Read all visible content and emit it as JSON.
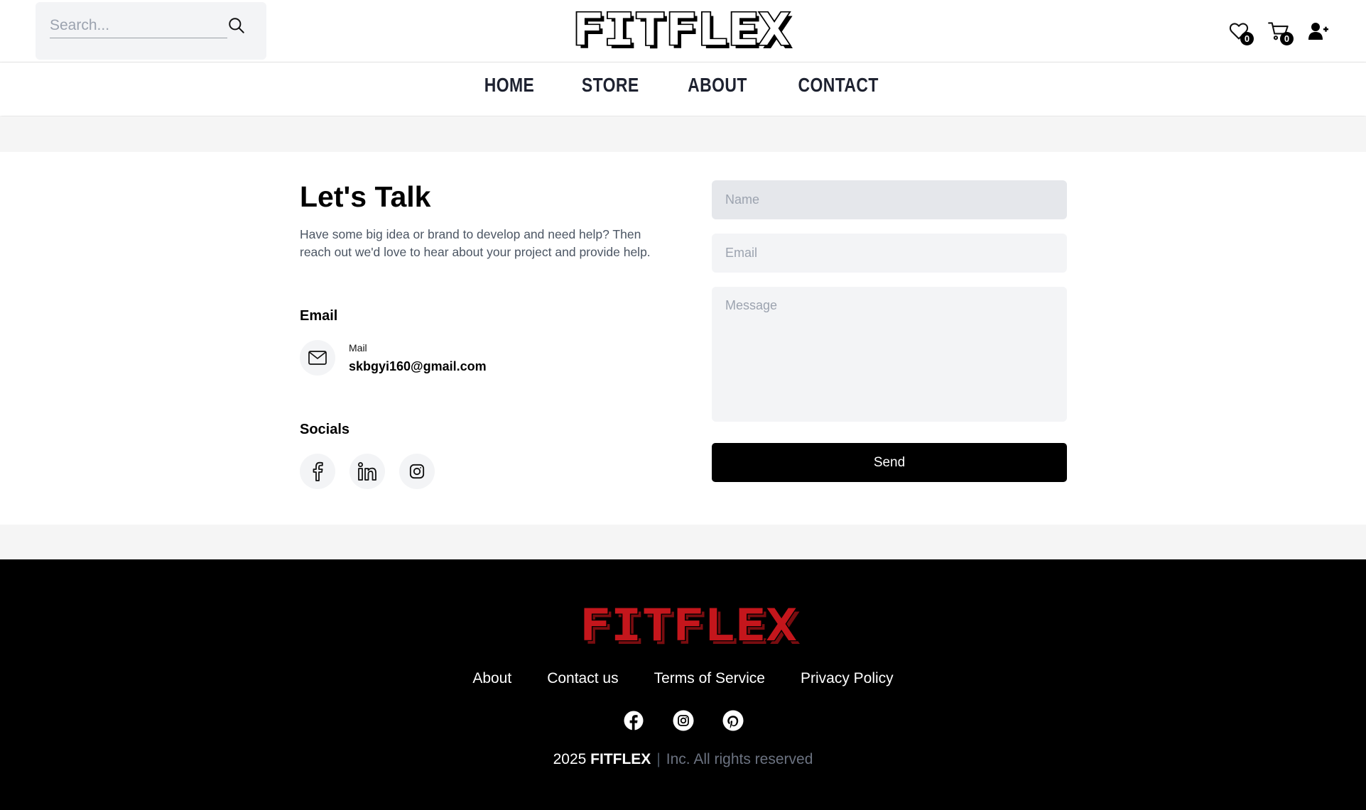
{
  "header": {
    "search": {
      "placeholder": "Search..."
    },
    "logo_text": "FITFLEX",
    "wishlist": {
      "count": "0",
      "icon": "heart-icon"
    },
    "cart": {
      "count": "0",
      "icon": "cart-icon"
    },
    "account": {
      "icon": "user-plus-icon"
    }
  },
  "nav": {
    "items": [
      {
        "label": "HOME"
      },
      {
        "label": "STORE"
      },
      {
        "label": "ABOUT"
      },
      {
        "label": "CONTACT"
      }
    ]
  },
  "contact": {
    "heading": "Let's Talk",
    "intro": "Have some big idea or brand to develop and need help? Then reach out we'd love to hear about your project and provide help.",
    "email_section_title": "Email",
    "mail_label": "Mail",
    "mail_value": "skbgyi160@gmail.com",
    "socials_title": "Socials",
    "socials": [
      "facebook-icon",
      "linkedin-icon",
      "instagram-icon"
    ]
  },
  "form": {
    "name_placeholder": "Name",
    "email_placeholder": "Email",
    "message_placeholder": "Message",
    "send_label": "Send"
  },
  "footer": {
    "logo_text": "FITFLEX",
    "links": [
      {
        "label": "About"
      },
      {
        "label": "Contact us"
      },
      {
        "label": "Terms of Service"
      },
      {
        "label": "Privacy Policy"
      }
    ],
    "socials": [
      "facebook-icon",
      "instagram-icon",
      "pinterest-icon"
    ],
    "copyright_year": "2025",
    "copyright_brand": "FITFLEX",
    "copyright_rest": "Inc. All rights reserved"
  },
  "colors": {
    "logo_header": "#000000",
    "logo_footer": "#c4161c",
    "accent": "#000000"
  }
}
